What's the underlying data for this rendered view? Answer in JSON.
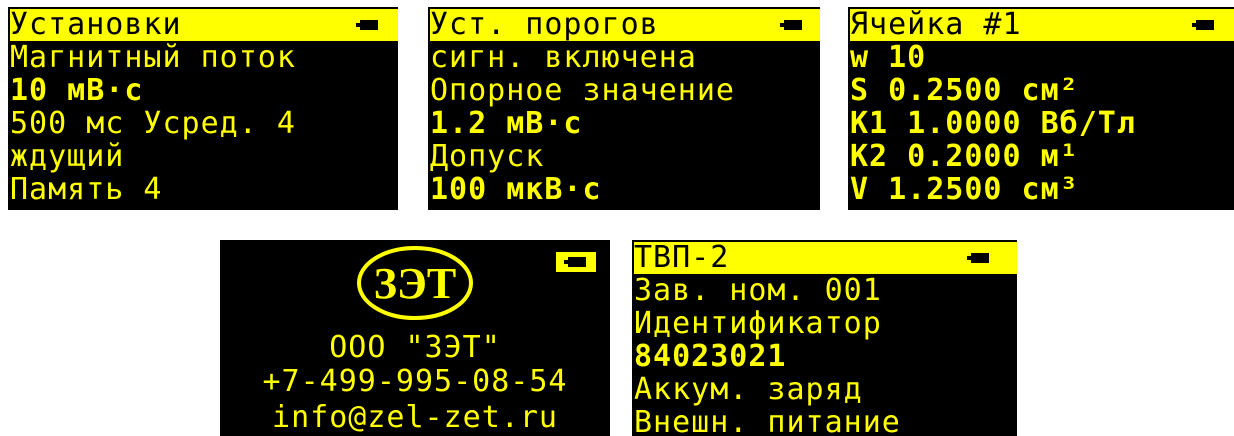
{
  "screens": {
    "settings": {
      "title": "Установки",
      "mode": "Магнитный поток",
      "range": "10 мВ·с",
      "time_avg": "500 мс  Усред. 4",
      "trigger": "ждущий",
      "memory": "Память 4"
    },
    "thresholds": {
      "title": "Уст. порогов",
      "signal": "сигн. включена",
      "ref_label": "Опорное значение",
      "ref_value": "1.2 мВ·с",
      "tol_label": "Допуск",
      "tol_value": "100 мкВ·с"
    },
    "cell": {
      "title": "Ячейка #1",
      "w": "w 10",
      "s": "S 0.2500 см²",
      "k1": "K1 1.0000 Вб/Тл",
      "k2": "K2 0.2000 м¹",
      "v": "V 1.2500 см³"
    },
    "about": {
      "logo_text": "ЗЭТ",
      "company": "ООО \"ЗЭТ\"",
      "phone": "+7-499-995-08-54",
      "email": "info@zel-zet.ru"
    },
    "device": {
      "model": "ТВП-2",
      "serial": "Зав. ном. 001",
      "id_label": "Идентификатор",
      "id_value": "84023021",
      "battery": "Аккум. заряд",
      "power": "Внешн. питание"
    }
  },
  "icons": {
    "battery": "battery-icon"
  },
  "colors": {
    "screen_bg": "#000000",
    "text": "#ffff00"
  }
}
